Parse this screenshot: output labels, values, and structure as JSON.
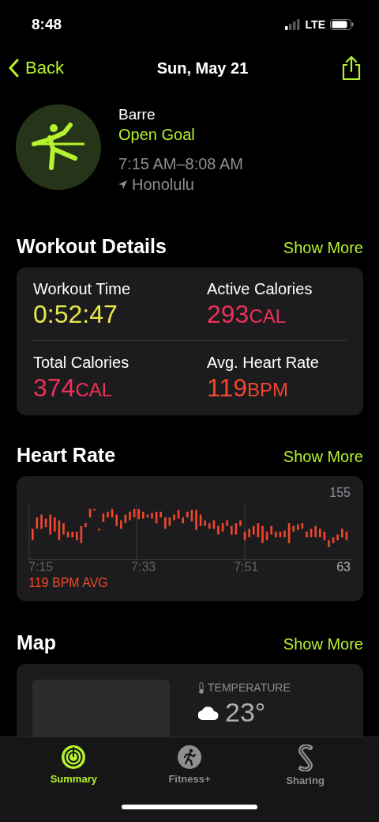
{
  "status_bar": {
    "time": "8:48",
    "network": "LTE"
  },
  "nav": {
    "back": "Back",
    "title": "Sun, May 21"
  },
  "workout": {
    "name": "Barre",
    "goal": "Open Goal",
    "time_range": "7:15 AM–8:08 AM",
    "location": "Honolulu"
  },
  "details": {
    "title": "Workout Details",
    "action": "Show More",
    "metrics": [
      {
        "label": "Workout Time",
        "value": "0:52:47",
        "color": "#e8e84a"
      },
      {
        "label": "Active Calories",
        "value": "293",
        "unit": "CAL",
        "color": "#f0305a"
      },
      {
        "label": "Total Calories",
        "value": "374",
        "unit": "CAL",
        "color": "#f0305a"
      },
      {
        "label": "Avg. Heart Rate",
        "value": "119",
        "unit": "BPM",
        "color": "#f2472c"
      }
    ]
  },
  "heart_rate": {
    "title": "Heart Rate",
    "action": "Show More",
    "max": "155",
    "min": "63",
    "times": [
      "7:15",
      "7:33",
      "7:51"
    ],
    "average": "119 BPM AVG"
  },
  "map": {
    "title": "Map",
    "action": "Show More",
    "temperature_label": "TEMPERATURE",
    "temperature": "23°"
  },
  "tabs": [
    {
      "label": "Summary",
      "kind": "summary",
      "selected": true
    },
    {
      "label": "Fitness+",
      "kind": "fitness",
      "selected": false
    },
    {
      "label": "Sharing",
      "kind": "sharing",
      "selected": false
    }
  ]
}
